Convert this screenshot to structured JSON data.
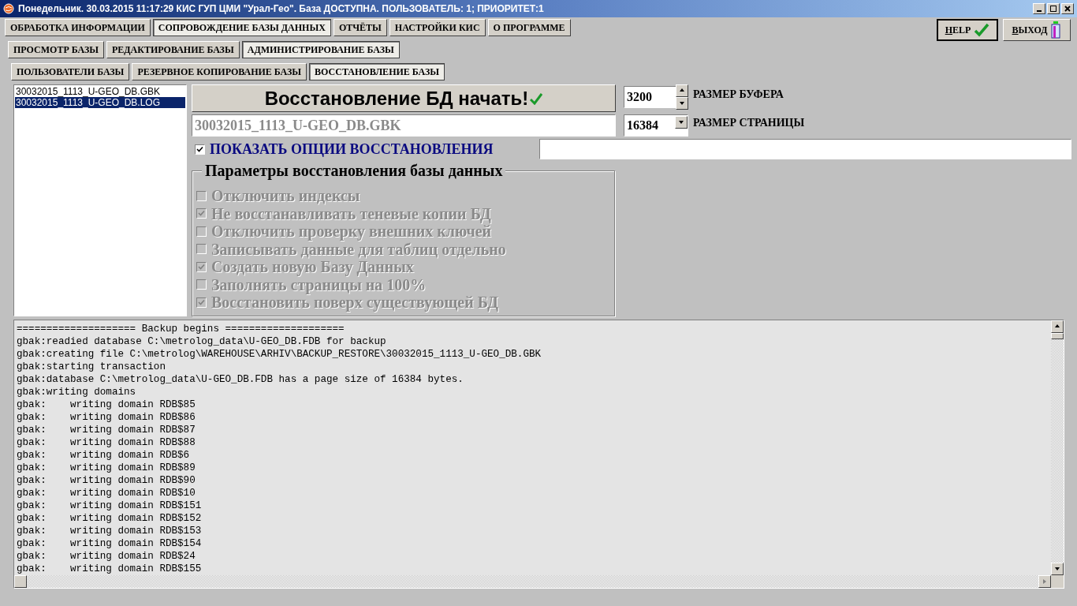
{
  "window": {
    "title": "Понедельник. 30.03.2015 11:17:29 КИС ГУП ЦМИ \"Урал-Гео\". База ДОСТУПНА. ПОЛЬЗОВАТЕЛЬ: 1; ПРИОРИТЕТ:1"
  },
  "main_tabs": [
    {
      "label": "ОБРАБОТКА ИНФОРМАЦИИ",
      "selected": false
    },
    {
      "label": "СОПРОВОЖДЕНИЕ БАЗЫ ДАННЫХ",
      "selected": true
    },
    {
      "label": "ОТЧЁТЫ",
      "selected": false
    },
    {
      "label": "НАСТРОЙКИ КИС",
      "selected": false
    },
    {
      "label": "О ПРОГРАММЕ",
      "selected": false
    }
  ],
  "sub_tabs": [
    {
      "label": "ПРОСМОТР БАЗЫ",
      "selected": false
    },
    {
      "label": "РЕДАКТИРОВАНИЕ БАЗЫ",
      "selected": false
    },
    {
      "label": "АДМИНИСТРИРОВАНИЕ БАЗЫ",
      "selected": true
    }
  ],
  "admin_tabs": [
    {
      "label": "ПОЛЬЗОВАТЕЛИ БАЗЫ",
      "selected": false
    },
    {
      "label": "РЕЗЕРВНОЕ КОПИРОВАНИЕ БАЗЫ",
      "selected": false
    },
    {
      "label": "ВОССТАНОВЛЕНИЕ БАЗЫ",
      "selected": true
    }
  ],
  "help_button": {
    "label": "HELP"
  },
  "exit_button": {
    "label": "ВЫХОД"
  },
  "files": [
    {
      "name": "30032015_1113_U-GEO_DB.GBK",
      "selected": false
    },
    {
      "name": "30032015_1113_U-GEO_DB.LOG",
      "selected": true
    }
  ],
  "start_button": {
    "label": "Восстановление БД начать!"
  },
  "file_field": {
    "value": "30032015_1113_U-GEO_DB.GBK"
  },
  "buffer_size": {
    "value": "3200",
    "label": "РАЗМЕР БУФЕРА"
  },
  "page_size": {
    "value": "16384",
    "label": "РАЗМЕР СТРАНИЦЫ"
  },
  "show_options": {
    "label": "ПОКАЗАТЬ ОПЦИИ ВОССТАНОВЛЕНИЯ",
    "checked": true
  },
  "options_group": {
    "title": "Параметры восстановления базы данных",
    "options": [
      {
        "label": "Отключить индексы",
        "checked": false,
        "disabled": true
      },
      {
        "label": "Не восстанавливать теневые копии БД",
        "checked": true,
        "disabled": true
      },
      {
        "label": "Отключить проверку внешних ключей",
        "checked": false,
        "disabled": true
      },
      {
        "label": "Записывать данные для таблиц отдельно",
        "checked": false,
        "disabled": true
      },
      {
        "label": "Создать новую Базу Данных",
        "checked": true,
        "disabled": true
      },
      {
        "label": "Заполнять страницы на 100%",
        "checked": false,
        "disabled": true
      },
      {
        "label": "Восстановить поверх существующей  БД",
        "checked": true,
        "disabled": true
      }
    ]
  },
  "log": [
    "==================== Backup begins ====================",
    "gbak:readied database C:\\metrolog_data\\U-GEO_DB.FDB for backup",
    "gbak:creating file C:\\metrolog\\WAREHOUSE\\ARHIV\\BACKUP_RESTORE\\30032015_1113_U-GEO_DB.GBK",
    "gbak:starting transaction",
    "gbak:database C:\\metrolog_data\\U-GEO_DB.FDB has a page size of 16384 bytes.",
    "gbak:writing domains",
    "gbak:    writing domain RDB$85",
    "gbak:    writing domain RDB$86",
    "gbak:    writing domain RDB$87",
    "gbak:    writing domain RDB$88",
    "gbak:    writing domain RDB$6",
    "gbak:    writing domain RDB$89",
    "gbak:    writing domain RDB$90",
    "gbak:    writing domain RDB$10",
    "gbak:    writing domain RDB$151",
    "gbak:    writing domain RDB$152",
    "gbak:    writing domain RDB$153",
    "gbak:    writing domain RDB$154",
    "gbak:    writing domain RDB$24",
    "gbak:    writing domain RDB$155"
  ]
}
